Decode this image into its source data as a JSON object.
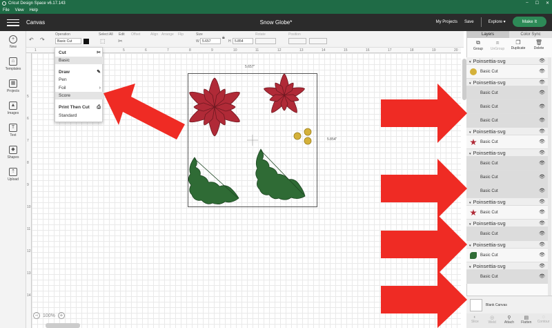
{
  "window": {
    "title": "Cricut Design Space  v6.17.143",
    "controls": [
      "–",
      "☐",
      "✕"
    ]
  },
  "menubar": [
    "File",
    "View",
    "Help"
  ],
  "header": {
    "section": "Canvas",
    "doc_title": "Snow Globe*",
    "my_projects": "My Projects",
    "save": "Save",
    "explore": "Explore ▾",
    "make_it": "Make It"
  },
  "toolbar": {
    "operation_label": "Operation",
    "operation_value": "Basic Cut",
    "select_all": "Select All",
    "edit": "Edit",
    "offset": "Offset",
    "align": "Align",
    "arrange": "Arrange",
    "flip": "Flip",
    "size": "Size",
    "w_label": "W",
    "w_value": "5.657",
    "h_label": "H",
    "h_value": "5.854",
    "rotate": "Rotate",
    "position": "Position"
  },
  "sidebar": [
    "New",
    "Templates",
    "Projects",
    "Images",
    "Text",
    "Shapes",
    "Upload"
  ],
  "ruler_top": [
    "1",
    "2",
    "3",
    "4",
    "5",
    "6",
    "7",
    "8",
    "9",
    "10",
    "11",
    "12",
    "13",
    "14",
    "15",
    "16",
    "17",
    "18",
    "19",
    "20"
  ],
  "ruler_left": [
    "5",
    "6",
    "7",
    "8",
    "9",
    "10",
    "11",
    "12",
    "13",
    "14"
  ],
  "dimensions": {
    "width": "5.657\"",
    "height": "5.854\""
  },
  "zoom": {
    "value": "100%"
  },
  "operation_menu": {
    "cut": "Cut",
    "basic": "Basic",
    "draw": "Draw",
    "pen": "Pen",
    "foil": "Foil",
    "score": "Score",
    "print_then_cut": "Print Then Cut",
    "standard": "Standard"
  },
  "layers_panel": {
    "tabs": [
      "Layers",
      "Color Sync"
    ],
    "tools": [
      "Group",
      "UnGroup",
      "Duplicate",
      "Delete"
    ],
    "rows": [
      {
        "type": "group",
        "name": "Poinsettia-svg"
      },
      {
        "type": "item",
        "name": "Basic Cut",
        "thumb": "dots",
        "shaded": false
      },
      {
        "type": "group",
        "name": "Poinsettia-svg"
      },
      {
        "type": "item",
        "name": "Basic Cut",
        "thumb": "",
        "shaded": true
      },
      {
        "type": "item",
        "name": "Basic Cut",
        "thumb": "",
        "shaded": true
      },
      {
        "type": "item",
        "name": "Basic Cut",
        "thumb": "",
        "shaded": true
      },
      {
        "type": "group",
        "name": "Poinsettia-svg"
      },
      {
        "type": "item",
        "name": "Basic Cut",
        "thumb": "red",
        "shaded": false
      },
      {
        "type": "group",
        "name": "Poinsettia-svg"
      },
      {
        "type": "item",
        "name": "Basic Cut",
        "thumb": "",
        "shaded": true
      },
      {
        "type": "item",
        "name": "Basic Cut",
        "thumb": "",
        "shaded": true
      },
      {
        "type": "item",
        "name": "Basic Cut",
        "thumb": "",
        "shaded": true
      },
      {
        "type": "group",
        "name": "Poinsettia-svg"
      },
      {
        "type": "item",
        "name": "Basic Cut",
        "thumb": "red",
        "shaded": false
      },
      {
        "type": "group",
        "name": "Poinsettia-svg"
      },
      {
        "type": "item",
        "name": "Basic Cut",
        "thumb": "",
        "shaded": true
      },
      {
        "type": "group",
        "name": "Poinsettia-svg"
      },
      {
        "type": "item",
        "name": "Basic Cut",
        "thumb": "green",
        "shaded": false
      },
      {
        "type": "group",
        "name": "Poinsettia-svg"
      },
      {
        "type": "item",
        "name": "Basic Cut",
        "thumb": "",
        "shaded": true
      }
    ],
    "blank_canvas": "Blank Canvas",
    "bottom_tools": [
      "Slice",
      "Weld",
      "Attach",
      "Flatten",
      "Contour"
    ]
  },
  "colors": {
    "brand_green": "#1f6b46",
    "make_it": "#2d8a57",
    "poinsettia_red": "#b02a37",
    "holly_green": "#2f6b35",
    "berry_gold": "#d4b13a",
    "arrow_red": "#ef2b24"
  }
}
